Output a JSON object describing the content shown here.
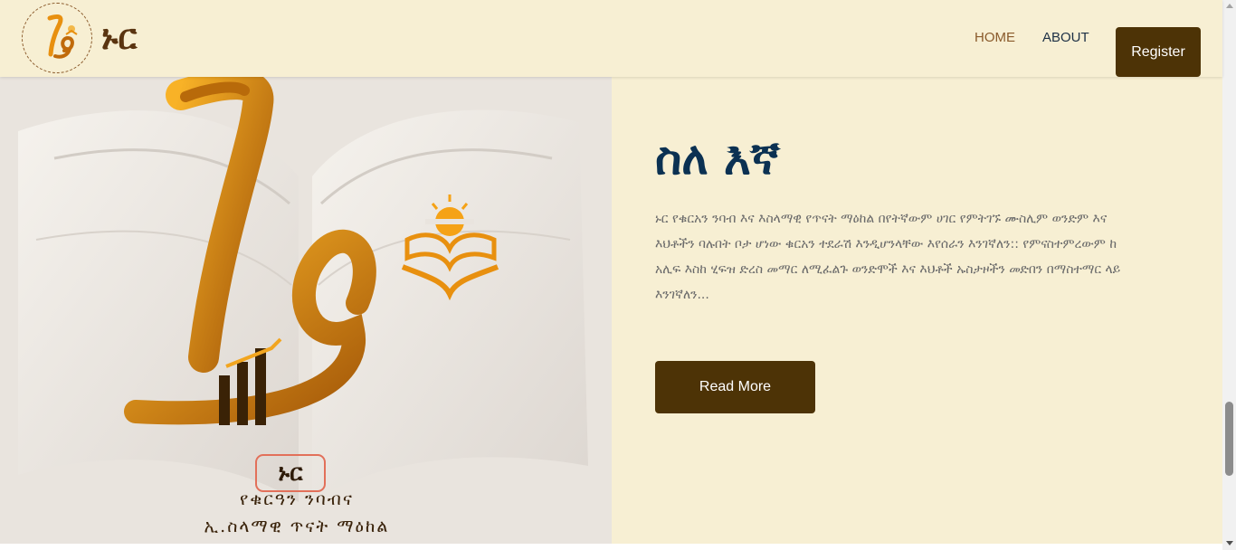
{
  "nav": {
    "brand": "ኑር",
    "links": [
      {
        "label": "HOME"
      },
      {
        "label": "ABOUT"
      }
    ],
    "register_label": "Register"
  },
  "hero": {
    "brand_text": "ኑር",
    "caption_line1": "የቁርዓን ንባብና",
    "caption_line2": "ኢ.ስላማዊ ጥናት ማዕከል"
  },
  "about": {
    "title": "ስለ እኛ",
    "body": "ኑር የቁርአን ንባብ እና እስላማዊ የጥናት ማዕከል በየትኛውም ሀገር የምትገኙ ሙስሊም ወንድም እና እህቶችን ባሉበት ቦታ ሆነው ቁርአን ተደራሽ እንዲሆንላቸው እየሰራን እንገኛለን:: የምናስተምረውም ከ አሊፍ እስከ ሂፍዝ ድረስ መማር ለሚፈልጉ ወንድሞች እና እህቶች ኡስታዞችን መድበን በማስተማር ላይ እንገኛለን...",
    "read_more_label": "Read More"
  },
  "colors": {
    "background": "#f7efd3",
    "accent_brown": "#4d3306",
    "title_blue": "#0b3152",
    "logo_orange": "#e8900f"
  },
  "scrollbar": {
    "position_fraction": 0.86
  }
}
